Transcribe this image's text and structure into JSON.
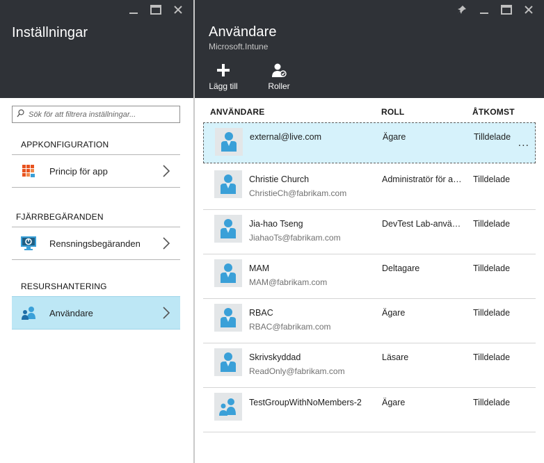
{
  "settings_blade": {
    "title": "Inställningar",
    "search_placeholder": "Sök för att filtrera inställningar...",
    "sections": [
      {
        "label": "APPKONFIGURATION",
        "item": {
          "label": "Princip för app",
          "icon": "app-policy-grid-icon"
        }
      },
      {
        "label": "FJÄRRBEGÄRANDEN",
        "item": {
          "label": "Rensningsbegäranden",
          "icon": "wipe-monitor-icon"
        }
      },
      {
        "label": "RESURSHANTERING",
        "item": {
          "label": "Användare",
          "icon": "users-icon"
        }
      }
    ]
  },
  "users_blade": {
    "title": "Användare",
    "subtitle": "Microsoft.Intune",
    "commands": [
      {
        "label": "Lägg till",
        "icon": "plus-icon"
      },
      {
        "label": "Roller",
        "icon": "roles-icon"
      }
    ],
    "columns": {
      "user": "ANVÄNDARE",
      "role": "ROLL",
      "access": "ÅTKOMST"
    },
    "more_label": "...",
    "rows": [
      {
        "name": "external@live.com",
        "email": "",
        "role": "Ägare",
        "access": "Tilldelade"
      },
      {
        "name": "Christie Church",
        "email": "ChristieCh@fabrikam.com",
        "role": "Administratör för an...",
        "access": "Tilldelade"
      },
      {
        "name": "Jia-hao Tseng",
        "email": "JiahaoTs@fabrikam.com",
        "role": "DevTest Lab-använd...",
        "access": "Tilldelade"
      },
      {
        "name": "MAM",
        "email": "MAM@fabrikam.com",
        "role": "Deltagare",
        "access": "Tilldelade"
      },
      {
        "name": "RBAC",
        "email": "RBAC@fabrikam.com",
        "role": "Ägare",
        "access": "Tilldelade"
      },
      {
        "name": "Skrivskyddad",
        "email": "ReadOnly@fabrikam.com",
        "role": "Läsare",
        "access": "Tilldelade"
      },
      {
        "name": "TestGroupWithNoMembers-2",
        "email": "",
        "role": "Ägare",
        "access": "Tilldelade"
      }
    ]
  },
  "colors": {
    "header_bg": "#2f3237",
    "selected_row_bg": "#d6f2fb",
    "active_nav_bg": "#bde7f5",
    "icon_blue": "#3aa0d8"
  }
}
